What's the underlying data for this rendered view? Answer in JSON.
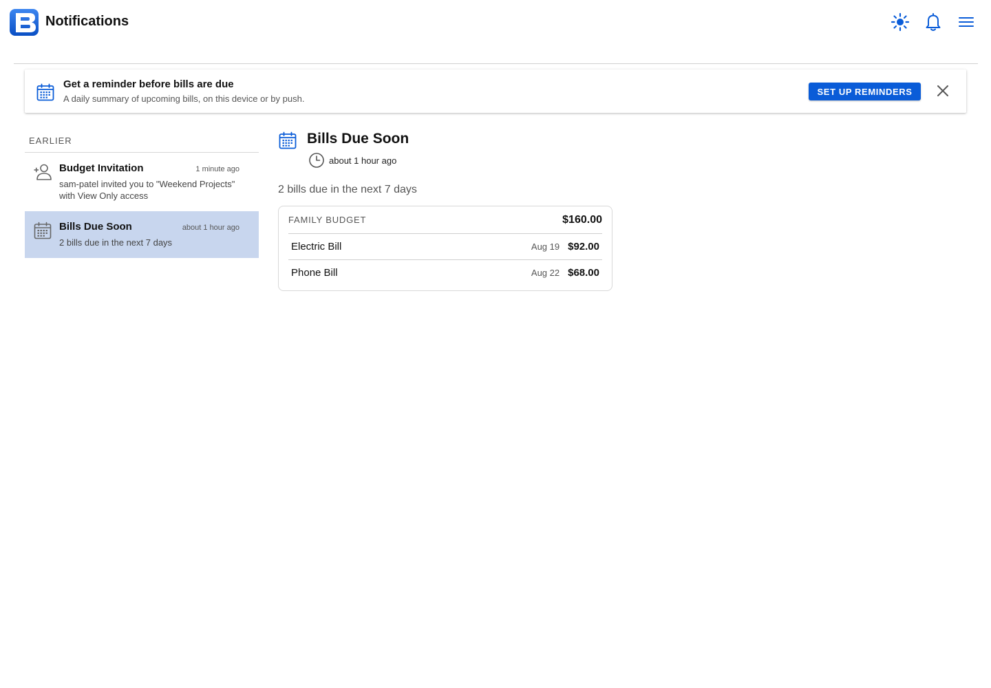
{
  "app": {
    "title": "Notifications",
    "logo_letter": "B",
    "accent": "#0a5cd8"
  },
  "header": {
    "icons": [
      "sun-icon",
      "bell-icon",
      "hamburger-menu-icon"
    ]
  },
  "banner": {
    "title": "Get a reminder before bills are due",
    "subtitle": "A daily summary of upcoming bills, on this device or by push.",
    "cta_label": "SET UP REMINDERS",
    "icon": "calendar-icon",
    "close_icon": "close-icon"
  },
  "list": {
    "heading": "EARLIER",
    "items": [
      {
        "title": "Budget Invitation",
        "time": "1 minute ago",
        "body": "sam-patel invited you to \"Weekend Projects\" with View Only access",
        "icon": "add-person-icon",
        "selected": false
      },
      {
        "title": "Bills Due Soon",
        "time": "about 1 hour ago",
        "body": "2 bills due in the next 7 days",
        "icon": "calendar-icon",
        "selected": true
      }
    ],
    "selected_color": "#c8d6ee"
  },
  "detail": {
    "title": "Bills Due Soon",
    "time": "about 1 hour ago",
    "summary": "2 bills due in the next 7 days",
    "card": {
      "budget_name": "FAMILY BUDGET",
      "total": "$160.00",
      "bills": [
        {
          "name": "Electric Bill",
          "date": "Aug 19",
          "amount": "$92.00"
        },
        {
          "name": "Phone Bill",
          "date": "Aug 22",
          "amount": "$68.00"
        }
      ]
    }
  }
}
